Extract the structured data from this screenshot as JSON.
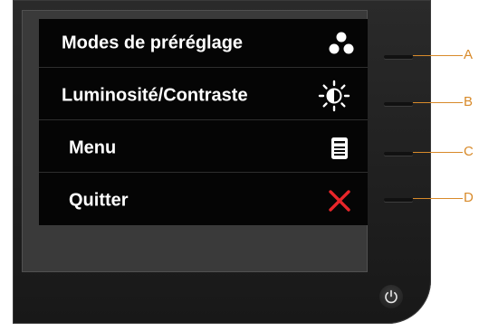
{
  "osd_menu": {
    "items": [
      {
        "label": "Modes de  préréglage",
        "icon": "preset-modes-icon",
        "button": "A"
      },
      {
        "label": "Luminosité/Contraste",
        "icon": "brightness-contrast-icon",
        "button": "B"
      },
      {
        "label": "Menu",
        "icon": "menu-icon",
        "button": "C"
      },
      {
        "label": "Quitter",
        "icon": "exit-x-icon",
        "button": "D"
      }
    ]
  },
  "colors": {
    "osd_background": "#050505",
    "label_text": "#ffffff",
    "exit_icon": "#e8262a",
    "callout": "#d88a2a"
  }
}
